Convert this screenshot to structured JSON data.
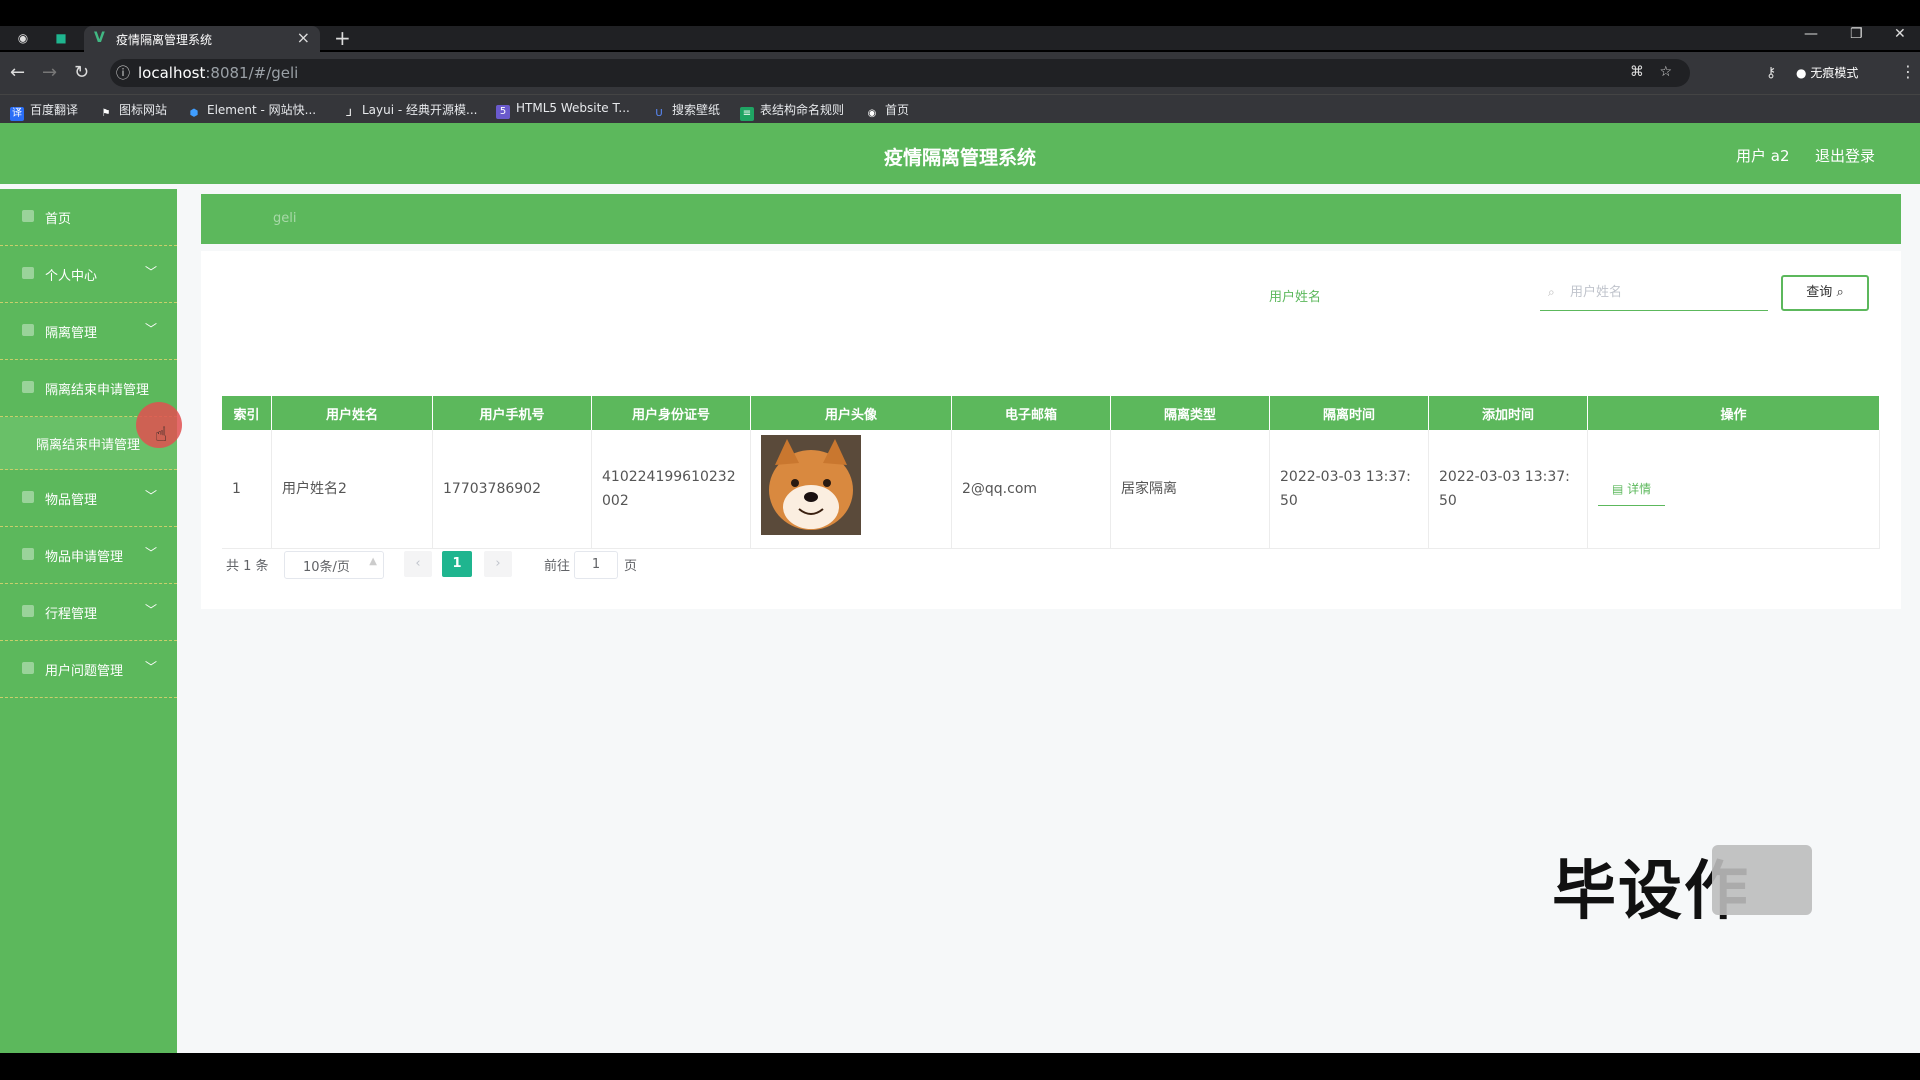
{
  "browser": {
    "tab_title": "疫情隔离管理系统",
    "url_host": "localhost",
    "url_path": ":8081/#/geli",
    "incognito_label": "无痕模式",
    "bookmarks": [
      {
        "label": "百度翻译",
        "icon": "translate-icon"
      },
      {
        "label": "图标网站",
        "icon": "flag-icon"
      },
      {
        "label": "Element - 网站快...",
        "icon": "element-icon"
      },
      {
        "label": "Layui - 经典开源模...",
        "icon": "layui-icon"
      },
      {
        "label": "HTML5 Website T...",
        "icon": "html5-icon"
      },
      {
        "label": "搜索壁纸",
        "icon": "wallpaper-icon"
      },
      {
        "label": "表结构命名规则",
        "icon": "sheet-icon"
      },
      {
        "label": "首页",
        "icon": "globe-icon"
      }
    ]
  },
  "app": {
    "title": "疫情隔离管理系统",
    "user_label": "用户 a2",
    "logout_label": "退出登录"
  },
  "sidebar": {
    "items": [
      {
        "label": "首页"
      },
      {
        "label": "个人中心"
      },
      {
        "label": "隔离管理"
      },
      {
        "label": "隔离结束申请管理"
      },
      {
        "label": "隔离结束申请管理"
      },
      {
        "label": "物品管理"
      },
      {
        "label": "物品申请管理"
      },
      {
        "label": "行程管理"
      },
      {
        "label": "用户问题管理"
      }
    ]
  },
  "breadcrumb": {
    "current": "geli"
  },
  "search": {
    "label": "用户姓名",
    "placeholder": "用户姓名",
    "button_label": "查询"
  },
  "table": {
    "columns": [
      "索引",
      "用户姓名",
      "用户手机号",
      "用户身份证号",
      "用户头像",
      "电子邮箱",
      "隔离类型",
      "隔离时间",
      "添加时间",
      "操作"
    ],
    "rows": [
      {
        "index": "1",
        "name": "用户姓名2",
        "phone": "17703786902",
        "id_card": "410224199610232002",
        "email": "2@qq.com",
        "isolation_type": "居家隔离",
        "isolation_time": "2022-03-03 13:37:50",
        "added_time": "2022-03-03 13:37:50",
        "action": "详情"
      }
    ]
  },
  "pagination": {
    "total": "共 1 条",
    "page_size": "10条/页",
    "current_page": "1",
    "goto_prefix": "前往",
    "goto_value": "1",
    "goto_suffix": "页"
  },
  "watermark": "毕设作"
}
